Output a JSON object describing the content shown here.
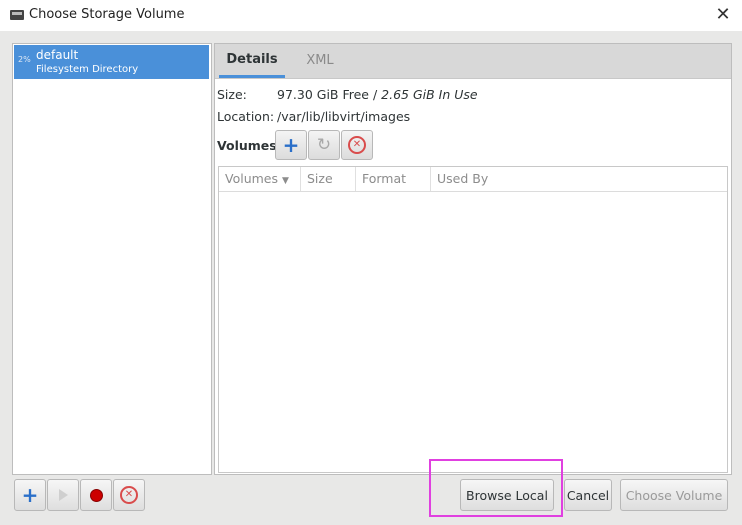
{
  "window": {
    "title": "Choose Storage Volume"
  },
  "pools": [
    {
      "percent": "2%",
      "name": "default",
      "type": "Filesystem Directory"
    }
  ],
  "tabs": [
    {
      "label": "Details"
    },
    {
      "label": "XML"
    }
  ],
  "details": {
    "size_label": "Size:",
    "size_free": "97.30 GiB Free",
    "size_sep": " / ",
    "size_in_use": "2.65 GiB In Use",
    "location_label": "Location:",
    "location_value": "/var/lib/libvirt/images",
    "volumes_label": "Volumes"
  },
  "volumes_table": {
    "columns": [
      "Volumes",
      "Size",
      "Format",
      "Used By"
    ],
    "rows": []
  },
  "buttons": {
    "browse_local": "Browse Local",
    "cancel": "Cancel",
    "choose_volume": "Choose Volume"
  },
  "colors": {
    "selection": "#4a90d9",
    "highlight": "#e040e0",
    "delete": "#d94c4c",
    "record": "#cc0000"
  }
}
